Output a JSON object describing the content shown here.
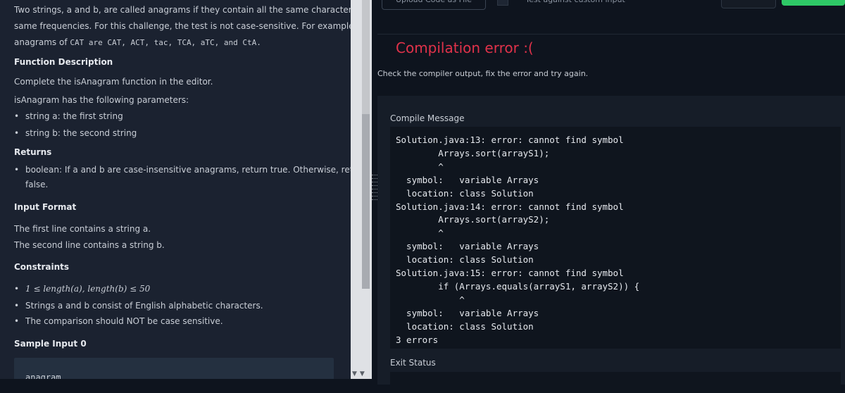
{
  "problem": {
    "intro_line1": "Two strings, a and b, are called anagrams if they contain all the same characters in the",
    "intro_line2": "same frequencies. For this challenge, the test is not case-sensitive. For example, the",
    "intro_line3_pre": "anagrams of",
    "intro_line3_code": "CAT are CAT, ACT, tac, TCA, aTC, and CtA.",
    "fd_heading": "Function Description",
    "fd_text": "Complete the isAnagram function in the editor.",
    "params_text": "isAnagram has the following parameters:",
    "param1": "string a: the first string",
    "param2": "string b: the second string",
    "returns_heading": "Returns",
    "returns_line1": "boolean: If a and b are case-insensitive anagrams, return true. Otherwise, return",
    "returns_line2": "false.",
    "input_heading": "Input Format",
    "input_line1": "The first line contains a string a.",
    "input_line2": "The second line contains a string b.",
    "constraints_heading": "Constraints",
    "constraint1": "1 ≤ length(a), length(b) ≤ 50",
    "constraint2": "Strings a and b consist of English alphabetic characters.",
    "constraint3": "The comparison should NOT be case sensitive.",
    "sample_heading": "Sample Input 0",
    "sample_value": "anagram"
  },
  "result": {
    "title": "Compilation error :(",
    "subtitle": "Check the compiler output, fix the error and try again.",
    "compile_label": "Compile Message",
    "compile_output": "Solution.java:13: error: cannot find symbol\n        Arrays.sort(arrayS1);\n        ^\n  symbol:   variable Arrays\n  location: class Solution\nSolution.java:14: error: cannot find symbol\n        Arrays.sort(arrayS2);\n        ^\n  symbol:   variable Arrays\n  location: class Solution\nSolution.java:15: error: cannot find symbol\n        if (Arrays.equals(arrayS1, arrayS2)) {\n            ^\n  symbol:   variable Arrays\n  location: class Solution\n3 errors",
    "exit_label": "Exit Status"
  },
  "toolbar": {
    "upload_label": "Upload Code as File",
    "test_label": "Test against custom input"
  },
  "colors": {
    "error": "#e0324a",
    "submit": "#2ec866",
    "panel": "#161d28",
    "left_bg": "#1b2230"
  }
}
